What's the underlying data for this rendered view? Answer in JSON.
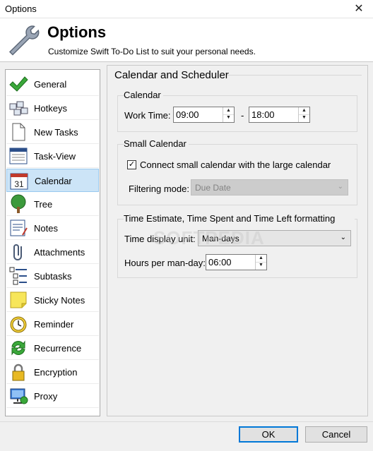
{
  "window": {
    "title": "Options",
    "close_glyph": "✕"
  },
  "header": {
    "title": "Options",
    "subtitle": "Customize Swift To-Do List to suit your personal needs.",
    "icon": "wrench-icon"
  },
  "sidebar": {
    "items": [
      {
        "label": "General",
        "icon": "checkmark-icon"
      },
      {
        "label": "Hotkeys",
        "icon": "keyboard-icon"
      },
      {
        "label": "New Tasks",
        "icon": "new-document-icon"
      },
      {
        "label": "Task-View",
        "icon": "task-view-icon"
      },
      {
        "label": "Calendar",
        "icon": "calendar-icon",
        "selected": true,
        "day": "31"
      },
      {
        "label": "Tree",
        "icon": "tree-icon"
      },
      {
        "label": "Notes",
        "icon": "notes-icon"
      },
      {
        "label": "Attachments",
        "icon": "paperclip-icon"
      },
      {
        "label": "Subtasks",
        "icon": "subtasks-icon"
      },
      {
        "label": "Sticky Notes",
        "icon": "sticky-note-icon"
      },
      {
        "label": "Reminder",
        "icon": "clock-icon"
      },
      {
        "label": "Recurrence",
        "icon": "recurrence-icon"
      },
      {
        "label": "Encryption",
        "icon": "padlock-icon"
      },
      {
        "label": "Proxy",
        "icon": "network-icon"
      }
    ]
  },
  "content": {
    "title": "Calendar and Scheduler",
    "calendar_group": {
      "title": "Calendar",
      "work_time_label": "Work Time:",
      "start": "09:00",
      "separator": "-",
      "end": "18:00"
    },
    "small_calendar_group": {
      "title": "Small Calendar",
      "connect_label": "Connect small calendar with the large calendar",
      "connect_checked": true,
      "check_glyph": "✓",
      "filtering_label": "Filtering mode:",
      "filtering_value": "Due Date"
    },
    "time_group": {
      "title": "Time Estimate, Time Spent and Time Left formatting",
      "unit_label": "Time display unit:",
      "unit_value": "Man-days",
      "hours_label": "Hours per man-day:",
      "hours_value": "06:00"
    }
  },
  "watermark": "SOFTPEDIA",
  "buttons": {
    "ok": "OK",
    "cancel": "Cancel"
  },
  "glyphs": {
    "spin_up": "▲",
    "spin_down": "▼",
    "dropdown": "⌄"
  },
  "colors": {
    "selected_bg": "#cce4f7",
    "default_button_border": "#0078d7"
  }
}
